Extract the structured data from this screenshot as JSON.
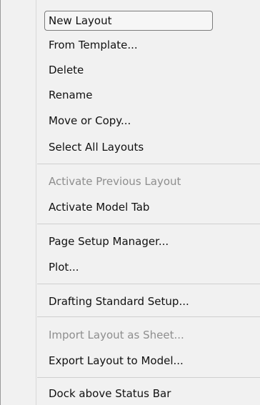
{
  "menu": {
    "items": [
      {
        "label": "New Layout"
      },
      {
        "label": "From Template..."
      },
      {
        "label": "Delete"
      },
      {
        "label": "Rename"
      },
      {
        "label": "Move or Copy..."
      },
      {
        "label": "Select All Layouts"
      },
      {
        "label": "Activate Previous Layout",
        "disabled": true
      },
      {
        "label": "Activate Model Tab"
      },
      {
        "label": "Page Setup Manager..."
      },
      {
        "label": "Plot..."
      },
      {
        "label": "Drafting Standard Setup..."
      },
      {
        "label": "Import Layout as Sheet...",
        "disabled": true
      },
      {
        "label": "Export Layout to Model..."
      },
      {
        "label": "Dock above Status Bar"
      }
    ]
  }
}
